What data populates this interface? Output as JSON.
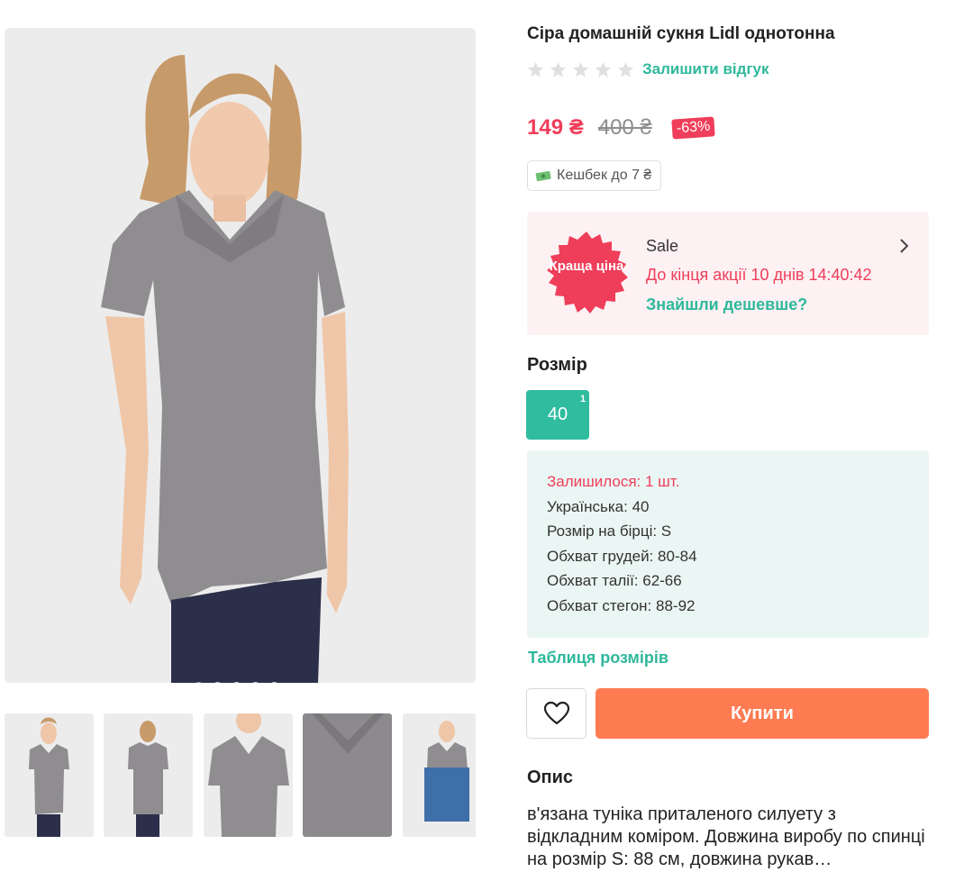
{
  "product": {
    "title": "Сіра домашній сукня Lidl однотонна",
    "rating_stars": 0,
    "review_link": "Залишити відгук",
    "price": "149 ₴",
    "old_price": "400 ₴",
    "discount": "-63%",
    "cashback": "Кешбек до 7 ₴"
  },
  "promo": {
    "badge": "Краща ціна",
    "label": "Sale",
    "timer": "До кінця акції 10 днів 14:40:42",
    "cheaper_link": "Знайшли дешевше?"
  },
  "sizes": {
    "title": "Розмір",
    "options": [
      {
        "label": "40",
        "count": "1"
      }
    ]
  },
  "size_info": {
    "remaining": "Залишилося: 1 шт.",
    "ukrainian": "Українська: 40",
    "tag_size": "Розмір на бірці: S",
    "chest": "Обхват грудей: 80-84",
    "waist": "Обхват талії: 62-66",
    "hips": "Обхват стегон: 88-92"
  },
  "size_table_link": "Таблиця розмірів",
  "actions": {
    "buy_label": "Купити"
  },
  "description": {
    "title": "Опис",
    "text": "в'язана туніка приталеного силуету з відкладним коміром. Довжина виробу по спинці на розмір S: 88 см, довжина рукав…"
  },
  "gallery": {
    "slide_count": 5,
    "active_slide": 1,
    "thumb_count": 5
  },
  "colors": {
    "accent_green": "#2fb89c",
    "price_red": "#ef3e5a",
    "buy_orange": "#ff7b52"
  }
}
